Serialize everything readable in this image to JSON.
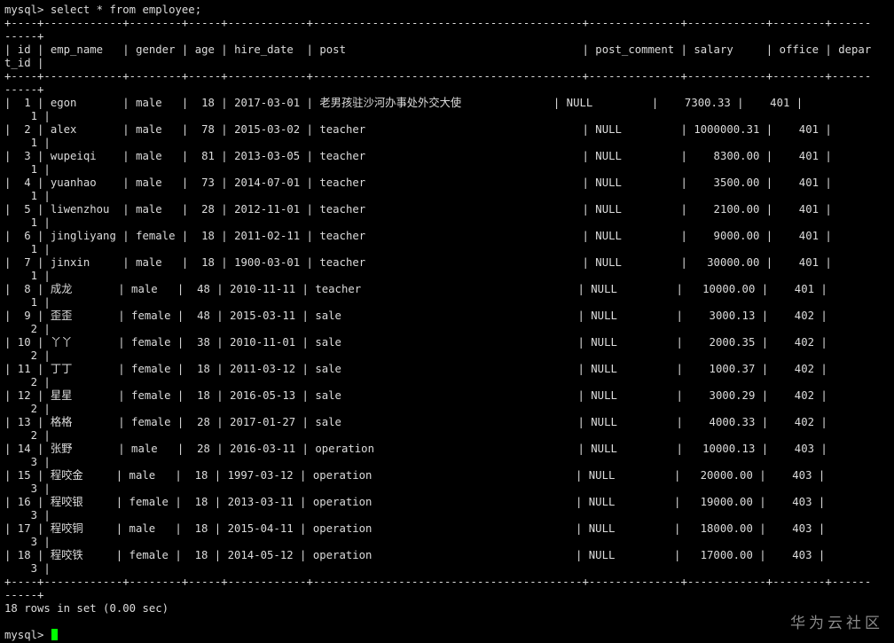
{
  "terminal": {
    "prompt": "mysql> ",
    "command": "select * from employee;",
    "border_top": "+----+------------+--------+-----+------------+-----------------------------------------+--------------+------------+--------+------",
    "border_wrap": "-----+",
    "header_main": "| id | emp_name   | gender | age | hire_date  | post                                    | post_comment | salary     | office | depar",
    "header_wrap": "t_id |",
    "rows": [
      {
        "main": "|  1 | egon       | male   |  18 | 2017-03-01 | 老男孩驻沙河办事处外交大使              | NULL         |    7300.33 |    401 |",
        "wrap": "    1 |"
      },
      {
        "main": "|  2 | alex       | male   |  78 | 2015-03-02 | teacher                                 | NULL         | 1000000.31 |    401 |",
        "wrap": "    1 |"
      },
      {
        "main": "|  3 | wupeiqi    | male   |  81 | 2013-03-05 | teacher                                 | NULL         |    8300.00 |    401 |",
        "wrap": "    1 |"
      },
      {
        "main": "|  4 | yuanhao    | male   |  73 | 2014-07-01 | teacher                                 | NULL         |    3500.00 |    401 |",
        "wrap": "    1 |"
      },
      {
        "main": "|  5 | liwenzhou  | male   |  28 | 2012-11-01 | teacher                                 | NULL         |    2100.00 |    401 |",
        "wrap": "    1 |"
      },
      {
        "main": "|  6 | jingliyang | female |  18 | 2011-02-11 | teacher                                 | NULL         |    9000.00 |    401 |",
        "wrap": "    1 |"
      },
      {
        "main": "|  7 | jinxin     | male   |  18 | 1900-03-01 | teacher                                 | NULL         |   30000.00 |    401 |",
        "wrap": "    1 |"
      },
      {
        "main": "|  8 | 成龙       | male   |  48 | 2010-11-11 | teacher                                 | NULL         |   10000.00 |    401 |",
        "wrap": "    1 |"
      },
      {
        "main": "|  9 | 歪歪       | female |  48 | 2015-03-11 | sale                                    | NULL         |    3000.13 |    402 |",
        "wrap": "    2 |"
      },
      {
        "main": "| 10 | 丫丫       | female |  38 | 2010-11-01 | sale                                    | NULL         |    2000.35 |    402 |",
        "wrap": "    2 |"
      },
      {
        "main": "| 11 | 丁丁       | female |  18 | 2011-03-12 | sale                                    | NULL         |    1000.37 |    402 |",
        "wrap": "    2 |"
      },
      {
        "main": "| 12 | 星星       | female |  18 | 2016-05-13 | sale                                    | NULL         |    3000.29 |    402 |",
        "wrap": "    2 |"
      },
      {
        "main": "| 13 | 格格       | female |  28 | 2017-01-27 | sale                                    | NULL         |    4000.33 |    402 |",
        "wrap": "    2 |"
      },
      {
        "main": "| 14 | 张野       | male   |  28 | 2016-03-11 | operation                               | NULL         |   10000.13 |    403 |",
        "wrap": "    3 |"
      },
      {
        "main": "| 15 | 程咬金     | male   |  18 | 1997-03-12 | operation                               | NULL         |   20000.00 |    403 |",
        "wrap": "    3 |"
      },
      {
        "main": "| 16 | 程咬银     | female |  18 | 2013-03-11 | operation                               | NULL         |   19000.00 |    403 |",
        "wrap": "    3 |"
      },
      {
        "main": "| 17 | 程咬铜     | male   |  18 | 2015-04-11 | operation                               | NULL         |   18000.00 |    403 |",
        "wrap": "    3 |"
      },
      {
        "main": "| 18 | 程咬铁     | female |  18 | 2014-05-12 | operation                               | NULL         |   17000.00 |    403 |",
        "wrap": "    3 |"
      }
    ],
    "result_summary": "18 rows in set (0.00 sec)"
  },
  "watermark": "华为云社区",
  "colors": {
    "background": "#000000",
    "text": "#dcdcdc",
    "cursor": "#00ff00",
    "watermark": "#8a8a8a"
  }
}
